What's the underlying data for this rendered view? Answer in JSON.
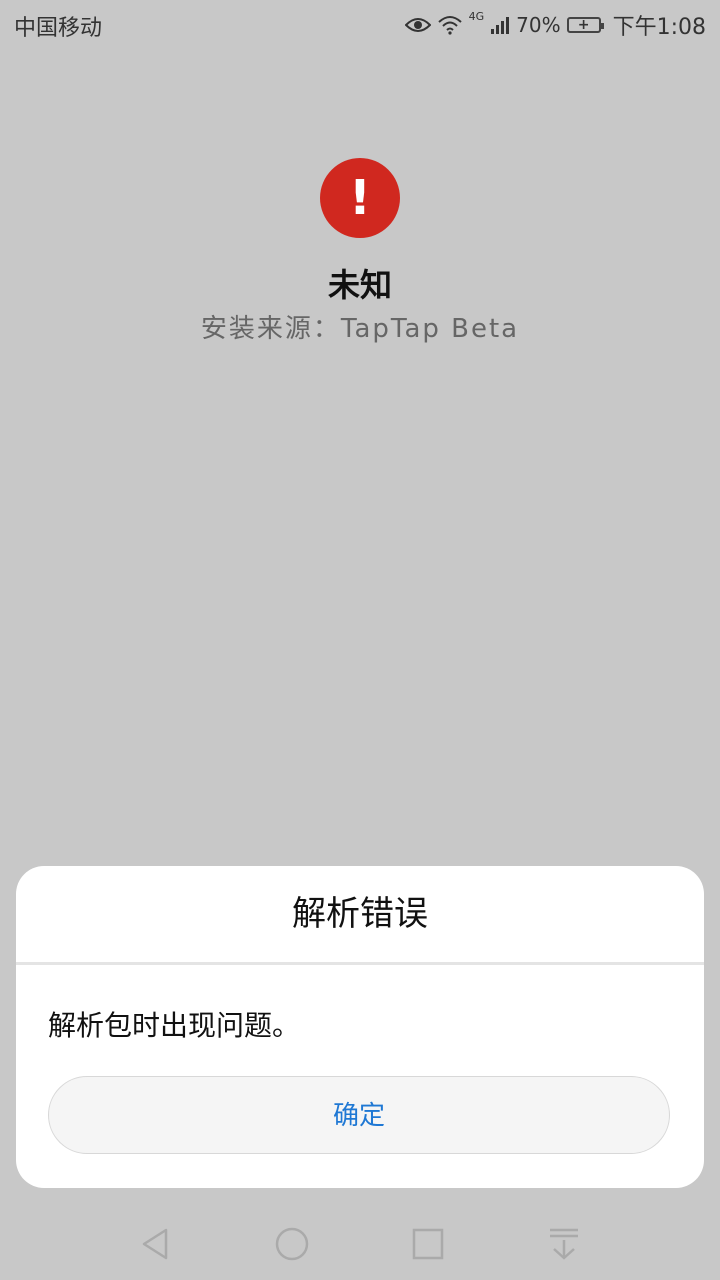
{
  "status_bar": {
    "carrier": "中国移动",
    "network": "4G",
    "battery": "70%",
    "time": "下午1:08"
  },
  "app": {
    "name": "未知",
    "install_source": "安装来源：TapTap Beta",
    "icon": "exclamation-icon",
    "icon_color": "#d0281f"
  },
  "dialog": {
    "title": "解析错误",
    "message": "解析包时出现问题。",
    "confirm_label": "确定",
    "accent": "#1f78d4"
  },
  "nav_bar": {
    "icons": [
      "back-icon",
      "home-icon",
      "recents-icon",
      "notification-pull-icon"
    ]
  }
}
